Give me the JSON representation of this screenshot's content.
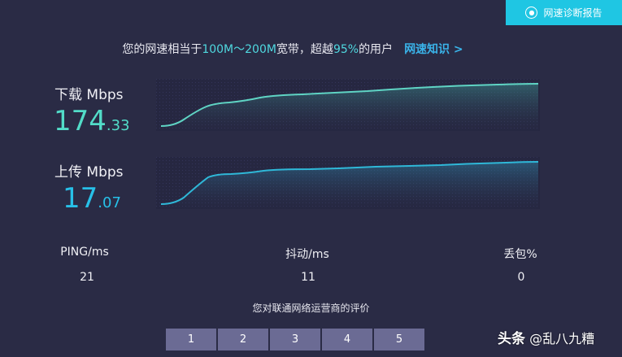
{
  "report_button": {
    "label": "网速诊断报告",
    "icon": "location-pin-icon"
  },
  "summary": {
    "prefix": "您的网速相当于",
    "bandwidth": "100M～200M",
    "middle": "宽带，超越",
    "percent": "95%",
    "suffix": "的用户",
    "link": "网速知识 >"
  },
  "download": {
    "label": "下载 Mbps",
    "int": "174",
    "dec": ".33"
  },
  "upload": {
    "label": "上传 Mbps",
    "int": "17",
    "dec": ".07"
  },
  "stats": [
    {
      "label": "PING/ms",
      "value": "21"
    },
    {
      "label": "抖动/ms",
      "value": "11"
    },
    {
      "label": "丢包%",
      "value": "0"
    }
  ],
  "rating": {
    "title": "您对联通网络运营商的评价",
    "options": [
      "1",
      "2",
      "3",
      "4",
      "5"
    ]
  },
  "watermark": {
    "brand": "头条",
    "handle": "@乱八九糟"
  },
  "colors": {
    "download_line": "#5fd4c4",
    "upload_line": "#2fb8d8",
    "report_bg": "#1fc6e3",
    "rating_bg": "#6b6b94"
  }
}
